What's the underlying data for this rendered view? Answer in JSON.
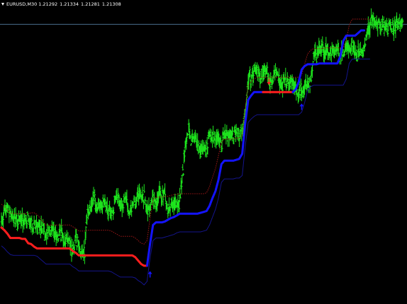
{
  "header": {
    "symbol": "EURUSD,M30",
    "open": "1.21292",
    "high": "1.21334",
    "low": "1.21281",
    "close": "1.21308"
  },
  "colors": {
    "background": "#000000",
    "bars": "#1EE61E",
    "trend_up": "#1414FF",
    "trend_down": "#FF1E1E",
    "upper_band": "#A01818",
    "lower_band": "#14148C",
    "bid_line": "#4A6E8C"
  },
  "chart_data": {
    "type": "ohlc",
    "symbol": "EURUSD",
    "timeframe": "M30",
    "grid": false,
    "ylim": [
      1.18,
      1.215
    ],
    "bid": 1.2122,
    "price_series": [
      1.1895,
      1.1906,
      1.1913,
      1.1905,
      1.1899,
      1.1895,
      1.1893,
      1.1897,
      1.1898,
      1.1898,
      1.1887,
      1.1892,
      1.1889,
      1.1888,
      1.1882,
      1.1879,
      1.1887,
      1.1886,
      1.1882,
      1.1877,
      1.1883,
      1.1874,
      1.1879,
      1.1869,
      1.1861,
      1.1879,
      1.1869,
      1.1859,
      1.1859,
      1.191,
      1.191,
      1.1925,
      1.1912,
      1.1915,
      1.1915,
      1.1912,
      1.1907,
      1.1906,
      1.1917,
      1.1919,
      1.1918,
      1.1914,
      1.1921,
      1.1906,
      1.191,
      1.1919,
      1.1926,
      1.1922,
      1.1921,
      1.1906,
      1.1911,
      1.1918,
      1.1916,
      1.1926,
      1.1925,
      1.1925,
      1.1906,
      1.1916,
      1.1915,
      1.1911,
      1.1919,
      1.1952,
      1.1983,
      1.2,
      1.1983,
      1.1996,
      1.1983,
      1.1974,
      1.198,
      1.1975,
      1.1995,
      1.1991,
      1.1991,
      1.199,
      1.1983,
      1.1997,
      1.1995,
      1.1995,
      1.1994,
      1.1998,
      1.1996,
      1.2003,
      1.2017,
      1.206,
      1.2061,
      1.2071,
      1.2065,
      1.206,
      1.2067,
      1.2069,
      1.206,
      1.2059,
      1.2066,
      1.2067,
      1.2051,
      1.2055,
      1.2058,
      1.2053,
      1.2058,
      1.2047,
      1.2044,
      1.2046,
      1.2045,
      1.2058,
      1.2055,
      1.2085,
      1.2085,
      1.2097,
      1.2095,
      1.2091,
      1.2093,
      1.2089,
      1.2092,
      1.2097,
      1.2085,
      1.2092,
      1.2096,
      1.209,
      1.2098,
      1.2084,
      1.2088,
      1.2086,
      1.2094,
      1.2111,
      1.2123,
      1.2125,
      1.2123,
      1.2124,
      1.2123,
      1.212,
      1.2117,
      1.2122,
      1.2119,
      1.2119,
      1.2122,
      1.2125
    ],
    "indicator": {
      "segments": [
        {
          "trend": "down",
          "levels": [
            1.1888,
            1.1885,
            1.1881,
            1.1876,
            1.1876,
            1.1876,
            1.1876,
            1.1875,
            1.1875,
            1.187,
            1.1869,
            1.1866,
            1.1864,
            1.1864,
            1.1864,
            1.1864,
            1.1864,
            1.1864,
            1.1864,
            1.1864,
            1.1864,
            1.1864,
            1.1864,
            1.1864,
            1.1861,
            1.1859,
            1.1856,
            1.1856,
            1.1856,
            1.1856,
            1.1856,
            1.1856,
            1.1856,
            1.1856,
            1.1856,
            1.1856,
            1.1856,
            1.1856,
            1.1856,
            1.1856,
            1.1856,
            1.1856,
            1.1856,
            1.1856,
            1.1856,
            1.1854,
            1.185,
            1.1846,
            1.1844,
            1.1844
          ]
        },
        {
          "trend": "up",
          "levels": [
            1.1844,
            1.1869,
            1.1891,
            1.1894,
            1.1894,
            1.1894,
            1.1895,
            1.1897,
            1.1899,
            1.19,
            1.1902,
            1.1904,
            1.1904,
            1.1904,
            1.1904,
            1.1904,
            1.1904,
            1.1904,
            1.1905,
            1.1906,
            1.1907,
            1.1913,
            1.1922,
            1.193,
            1.1943,
            1.1961,
            1.1965,
            1.1965,
            1.1965,
            1.1965,
            1.1966,
            1.1967,
            1.1973,
            1.2008,
            1.2035,
            1.204,
            1.2044,
            1.2044,
            1.2044,
            1.2044
          ]
        },
        {
          "trend": "down",
          "levels": [
            1.2044,
            1.2044,
            1.2044,
            1.2044,
            1.2044,
            1.2044,
            1.2044,
            1.2044,
            1.2044,
            1.2044,
            1.2044
          ]
        },
        {
          "trend": "up",
          "levels": [
            1.2044,
            1.2047,
            1.2056,
            1.207,
            1.2074,
            1.2076,
            1.2076,
            1.2076,
            1.2076,
            1.2077,
            1.2077,
            1.2077,
            1.2077,
            1.2077,
            1.2077,
            1.2077,
            1.2085,
            1.2103,
            1.2109,
            1.2109,
            1.2109,
            1.2109,
            1.2112,
            1.2115,
            1.2115
          ]
        }
      ],
      "upper_band": [
        1.1915,
        1.1912,
        1.1908,
        1.1905,
        1.1904,
        1.1904,
        1.1904,
        1.1904,
        1.1904,
        1.1904,
        1.1905,
        1.1905,
        1.1903,
        1.1899,
        1.1895,
        1.1891,
        1.1891,
        1.1891,
        1.1891,
        1.1891,
        1.1891,
        1.1891,
        1.1891,
        1.1891,
        1.1889,
        1.1887,
        1.1884,
        1.1884,
        1.1884,
        1.1885,
        1.1885,
        1.1885,
        1.1885,
        1.1885,
        1.1885,
        1.1885,
        1.1885,
        1.1884,
        1.1882,
        1.188,
        1.1878,
        1.1878,
        1.1878,
        1.1878,
        1.1878,
        1.1876,
        1.1873,
        1.187,
        1.1869,
        1.1873,
        1.1899,
        1.192,
        1.1923,
        1.1923,
        1.1923,
        1.1924,
        1.1924,
        1.1925,
        1.1926,
        1.1926,
        1.1927,
        1.1927,
        1.1927,
        1.1927,
        1.1927,
        1.1927,
        1.1927,
        1.1927,
        1.1927,
        1.1928,
        1.1935,
        1.1946,
        1.1956,
        1.1971,
        1.1986,
        1.199,
        1.199,
        1.199,
        1.199,
        1.1991,
        1.1991,
        1.1994,
        1.2025,
        1.2052,
        1.2056,
        1.2059,
        1.2061,
        1.2061,
        1.2061,
        1.2061,
        1.2061,
        1.2061,
        1.2061,
        1.2061,
        1.2061,
        1.2061,
        1.2061,
        1.2061,
        1.2061,
        1.2061,
        1.2061,
        1.2064,
        1.2076,
        1.2088,
        1.2092,
        1.2094,
        1.2094,
        1.2094,
        1.2094,
        1.2095,
        1.2095,
        1.2095,
        1.2095,
        1.2095,
        1.2095,
        1.2095,
        1.2103,
        1.2121,
        1.2128,
        1.2128,
        1.2128,
        1.2128,
        1.2128,
        1.2128,
        1.2128
      ],
      "lower_band": [
        1.1867,
        1.1864,
        1.186,
        1.1857,
        1.1856,
        1.1856,
        1.1856,
        1.1856,
        1.1856,
        1.1856,
        1.1856,
        1.1856,
        1.1855,
        1.1852,
        1.1849,
        1.1846,
        1.1846,
        1.1846,
        1.1846,
        1.1846,
        1.1846,
        1.1846,
        1.1846,
        1.1846,
        1.1843,
        1.1841,
        1.1838,
        1.1838,
        1.1838,
        1.1838,
        1.1838,
        1.1838,
        1.1838,
        1.1838,
        1.1838,
        1.1838,
        1.1838,
        1.1837,
        1.1835,
        1.1833,
        1.1831,
        1.1831,
        1.1831,
        1.1831,
        1.1831,
        1.183,
        1.1827,
        1.1825,
        1.1822,
        1.1826,
        1.1853,
        1.1873,
        1.1876,
        1.1876,
        1.1876,
        1.1877,
        1.1878,
        1.1879,
        1.188,
        1.1882,
        1.1883,
        1.1883,
        1.1883,
        1.1883,
        1.1883,
        1.1883,
        1.1883,
        1.1883,
        1.1884,
        1.1885,
        1.1891,
        1.19,
        1.1909,
        1.1922,
        1.194,
        1.1944,
        1.1944,
        1.1944,
        1.1944,
        1.1945,
        1.1945,
        1.1948,
        1.1981,
        1.2009,
        1.2013,
        1.2016,
        1.2018,
        1.2018,
        1.2018,
        1.2018,
        1.2018,
        1.2018,
        1.2018,
        1.2018,
        1.2018,
        1.2018,
        1.2018,
        1.2018,
        1.2018,
        1.2018,
        1.2018,
        1.2021,
        1.2032,
        1.2046,
        1.205,
        1.2052,
        1.2052,
        1.2052,
        1.2052,
        1.2052,
        1.2052,
        1.2052,
        1.2052,
        1.2052,
        1.2052,
        1.2052,
        1.2059,
        1.2077,
        1.2082,
        1.2082,
        1.2082,
        1.2082,
        1.2082,
        1.2082,
        1.2082
      ]
    },
    "signals": [
      {
        "type": "buy",
        "bar": 50,
        "price": 1.1837
      },
      {
        "type": "sell",
        "bar": 90,
        "price": 1.2053
      },
      {
        "type": "buy",
        "bar": 101,
        "price": 1.203
      }
    ]
  }
}
